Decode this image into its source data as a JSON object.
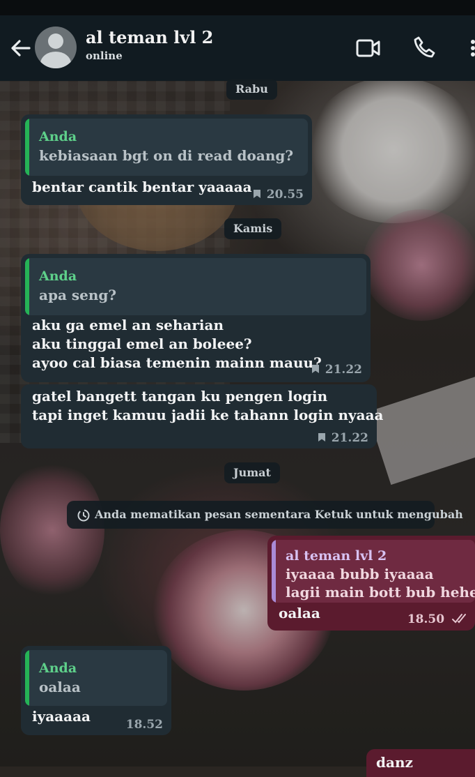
{
  "header": {
    "contact_name": "al teman lvl 2",
    "contact_status": "online",
    "icons": [
      "back-arrow-icon",
      "avatar-placeholder-icon",
      "video-call-icon",
      "phone-call-icon",
      "more-vert-icon"
    ]
  },
  "day_labels": {
    "rabu": "Rabu",
    "kamis": "Kamis",
    "jumat": "Jumat"
  },
  "messages": [
    {
      "direction": "incoming",
      "quote": {
        "name": "Anda",
        "text": "kebiasaan bgt on di read doang?"
      },
      "text": "bentar cantik bentar yaaaaa",
      "time": "20.55",
      "starred": true
    },
    {
      "direction": "incoming",
      "quote": {
        "name": "Anda",
        "text": "apa seng?"
      },
      "text": "aku ga emel an seharian\naku tinggal emel an boleee?\nayoo cal biasa temenin mainn mauu?",
      "time": "21.22",
      "starred": true
    },
    {
      "direction": "incoming",
      "text": "gatel bangett tangan ku pengen login\ntapi inget kamuu jadii ke tahann login nyaaa",
      "time": "21.22",
      "starred": true
    },
    {
      "direction": "outgoing",
      "quote": {
        "name": "al teman lvl 2",
        "text": "iyaaaa bubb iyaaaa\nlagii main bott bub hehe"
      },
      "text": "oalaa",
      "time": "18.50",
      "read": true
    },
    {
      "direction": "incoming",
      "quote": {
        "name": "Anda",
        "text": "oalaa"
      },
      "text": "iyaaaaa",
      "time": "18.52"
    },
    {
      "direction": "outgoing",
      "text": "danz",
      "partial": true
    }
  ],
  "system_notice": {
    "text": "Anda mematikan pesan sementara Ketuk untuk mengubah",
    "icon": "disappearing-timer-icon"
  },
  "colors": {
    "header_bg": "#111b21",
    "incoming_bubble": "#202c33",
    "outgoing_bubble": "#5b1b2e",
    "quote_bar_self": "#25b356",
    "quote_bar_contact": "#a98bd6",
    "quote_name_self": "#5ed08a",
    "quote_name_contact": "#d8c2f2"
  }
}
